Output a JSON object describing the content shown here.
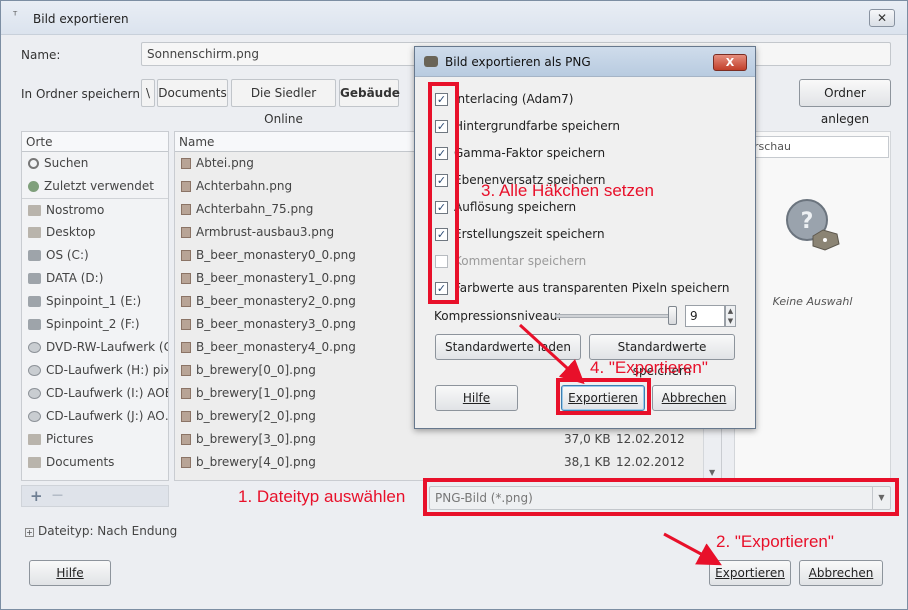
{
  "window": {
    "title": "Bild exportieren",
    "title_icon": "pin-icon",
    "close": "✕"
  },
  "name_row": {
    "label": "Name:",
    "value": "Sonnenschirm.png"
  },
  "folder_row": {
    "label": "In Ordner speichern:",
    "crumbs": [
      "\\",
      "Documents",
      "Die Siedler Online",
      "Gebäude"
    ],
    "create_folder": "Ordner anlegen"
  },
  "places": {
    "header": "Orte",
    "items": [
      {
        "label": "Suchen",
        "icon": "search-icon"
      },
      {
        "label": "Zuletzt verwendet",
        "icon": "recent-icon"
      },
      {
        "label": "Nostromo",
        "icon": "folder-icon"
      },
      {
        "label": "Desktop",
        "icon": "folder-icon"
      },
      {
        "label": "OS (C:)",
        "icon": "drive-icon"
      },
      {
        "label": "DATA (D:)",
        "icon": "drive-icon"
      },
      {
        "label": "Spinpoint_1 (E:)",
        "icon": "drive-icon"
      },
      {
        "label": "Spinpoint_2 (F:)",
        "icon": "drive-icon"
      },
      {
        "label": "DVD-RW-Laufwerk (G:)",
        "icon": "disc-icon"
      },
      {
        "label": "CD-Laufwerk (H:) pix…",
        "icon": "disc-icon"
      },
      {
        "label": "CD-Laufwerk (I:) AOE…",
        "icon": "disc-icon"
      },
      {
        "label": "CD-Laufwerk (J:) AO…",
        "icon": "disc-icon"
      },
      {
        "label": "Pictures",
        "icon": "folder-icon"
      },
      {
        "label": "Documents",
        "icon": "folder-icon"
      }
    ],
    "add": "+",
    "remove": "—"
  },
  "files": {
    "header_name": "Name",
    "rows": [
      {
        "name": "Abtei.png",
        "size": "",
        "date": ""
      },
      {
        "name": "Achterbahn.png",
        "size": "",
        "date": ""
      },
      {
        "name": "Achterbahn_75.png",
        "size": "",
        "date": ""
      },
      {
        "name": "Armbrust-ausbau3.png",
        "size": "",
        "date": ""
      },
      {
        "name": "B_beer_monastery0_0.png",
        "size": "",
        "date": ""
      },
      {
        "name": "B_beer_monastery1_0.png",
        "size": "",
        "date": ""
      },
      {
        "name": "B_beer_monastery2_0.png",
        "size": "",
        "date": ""
      },
      {
        "name": "B_beer_monastery3_0.png",
        "size": "",
        "date": ""
      },
      {
        "name": "B_beer_monastery4_0.png",
        "size": "",
        "date": ""
      },
      {
        "name": "b_brewery[0_0].png",
        "size": "",
        "date": ""
      },
      {
        "name": "b_brewery[1_0].png",
        "size": "",
        "date": ""
      },
      {
        "name": "b_brewery[2_0].png",
        "size": "",
        "date": ""
      },
      {
        "name": "b_brewery[3_0].png",
        "size": "37,0 KB",
        "date": "12.02.2012"
      },
      {
        "name": "b_brewery[4_0].png",
        "size": "38,1 KB",
        "date": "12.02.2012"
      }
    ]
  },
  "preview": {
    "header": "rschau",
    "empty_text": "Keine Auswahl"
  },
  "filetype": {
    "value": "PNG-Bild (*.png)",
    "expander": "Dateityp: Nach Endung"
  },
  "buttons": {
    "help": "Hilfe",
    "export": "Exportieren",
    "cancel": "Abbrechen"
  },
  "dialog": {
    "title": "Bild exportieren als PNG",
    "close": "X",
    "options": [
      {
        "label": "Interlacing (Adam7)",
        "checked": true
      },
      {
        "label": "Hintergrundfarbe speichern",
        "checked": true
      },
      {
        "label": "Gamma-Faktor speichern",
        "checked": true
      },
      {
        "label": "Ebenenversatz speichern",
        "checked": true
      },
      {
        "label": "Auflösung speichern",
        "checked": true
      },
      {
        "label": "Erstellungszeit speichern",
        "checked": true
      },
      {
        "label": "Kommentar speichern",
        "checked": false
      },
      {
        "label": "Farbwerte aus transparenten Pixeln speichern",
        "checked": true
      }
    ],
    "compression_label": "Kompressionsniveau:",
    "compression_value": "9",
    "compression_level": 1.0,
    "load_defaults": "Standardwerte laden",
    "save_defaults": "Standardwerte speichern",
    "help": "Hilfe",
    "export": "Exportieren",
    "cancel": "Abbrechen"
  },
  "annotations": {
    "step1": "1. Dateityp auswählen",
    "step2": "2. \"Exportieren\"",
    "step3": "3. Alle Häkchen setzen",
    "step4": "4. \"Exportieren\"",
    "color": "#e8102a"
  }
}
